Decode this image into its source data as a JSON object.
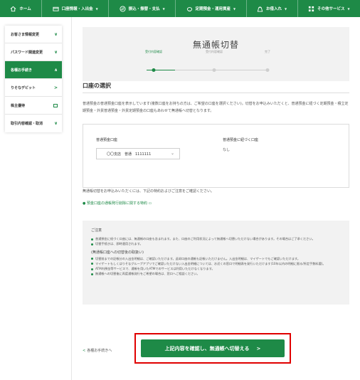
{
  "topnav": [
    {
      "label": "ホーム",
      "icon": "home-icon"
    },
    {
      "label": "口座情報・入出金",
      "icon": "card-icon"
    },
    {
      "label": "振込・振替・支払",
      "icon": "transfer-icon"
    },
    {
      "label": "定期預金・運用資産",
      "icon": "piggy-icon"
    },
    {
      "label": "お借入れ",
      "icon": "bag-icon"
    },
    {
      "label": "その他サービス",
      "icon": "grid-icon"
    }
  ],
  "sidebar": {
    "items": [
      {
        "label": "お客さま情報変更",
        "marker": "∨"
      },
      {
        "label": "パスワード関連変更",
        "marker": "∨"
      },
      {
        "label": "各種お手続き",
        "marker": "∧"
      },
      {
        "label": "りそなデビット",
        "marker": ">"
      },
      {
        "label": "株主優待",
        "marker": "ext"
      },
      {
        "label": "取引内容確認・取消",
        "marker": "∨"
      }
    ]
  },
  "page": {
    "title": "無通帳切替",
    "steps": [
      "受付内容確認",
      "受付内容確認",
      "完了"
    ]
  },
  "section": {
    "title": "口座の選択",
    "description": "普通預金の普通預金口座を表示しています(複数口座をお持ちの方は、ご希望の口座を選択ください)。切替をお申込みいただくと、普通預金に紐づく定期預金・積立定期預金・外貨普通預金・外貨定期預金の口座もあわせて無通帳へ切替となります。"
  },
  "account": {
    "label_ordinary": "普通預金口座",
    "selected": "〇〇支店　普通　1111111",
    "label_linked": "普通預金に紐づく口座",
    "linked_value": "なし"
  },
  "notice": {
    "text": "無通帳切替をお申込みいただくには、下記の特約およびご注意をご確認ください。",
    "link": "預金口座の通帳発行削除に関する特約"
  },
  "caution": {
    "heading": "ご注意",
    "items": [
      "普通預金に紐づく口座には、無通帳の口座も含まれます。また、口座のご利用状況によって無通帳へ切替いただけない場合があります。その場合はご了承ください。",
      "切替手続きは、即時適用されます。"
    ],
    "subheading": "(無通帳口座への切替後の取扱い)",
    "items2": [
      "切替前までの記帳分の入出金明細は、ご確認いただけます。返却口座の通帳も記帳いただけません。入出金明細は、マイゲートでもご確認いただけます。",
      "マイゲートもしくはりそなグループアプリでご確認いただけない入出金明細については、お近くの窓口で明細表を発行いただけます(10年以内の明細に限る/所定手数料要)。",
      "ATM内預金等サービスで、通帳を用いたATMでのサービスは利用いただけなくなります。",
      "無通帳への切替後に再度通帳発行をご希望の場合は、窓口へご相談ください。"
    ]
  },
  "footer": {
    "back_label": "各種お手続きへ",
    "confirm_label": "上記内容を確認し、無通帳へ切替える"
  },
  "colors": {
    "brand": "#1e8a47",
    "highlight_border": "#e00000"
  }
}
